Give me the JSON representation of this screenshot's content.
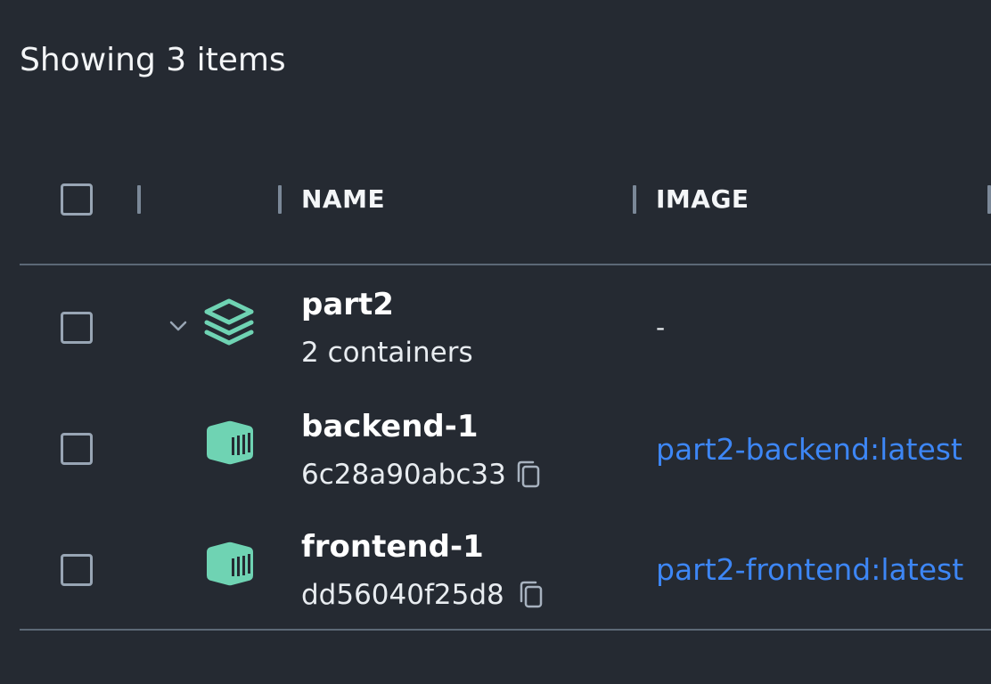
{
  "summary": "Showing 3 items",
  "table": {
    "columns": {
      "name": "NAME",
      "image": "IMAGE"
    },
    "rows": [
      {
        "type": "group",
        "icon": "stack-layers-icon",
        "name": "part2",
        "sub": "2 containers",
        "image": "-"
      },
      {
        "type": "container",
        "icon": "container-icon",
        "name": "backend-1",
        "sub": "6c28a90abc33",
        "image": "part2-backend:latest"
      },
      {
        "type": "container",
        "icon": "container-icon",
        "name": "frontend-1",
        "sub": "dd56040f25d8",
        "image": "part2-frontend:latest"
      }
    ]
  },
  "colors": {
    "background": "#252a32",
    "icon_green": "#6fd3b3",
    "link_blue": "#3d86f5"
  }
}
